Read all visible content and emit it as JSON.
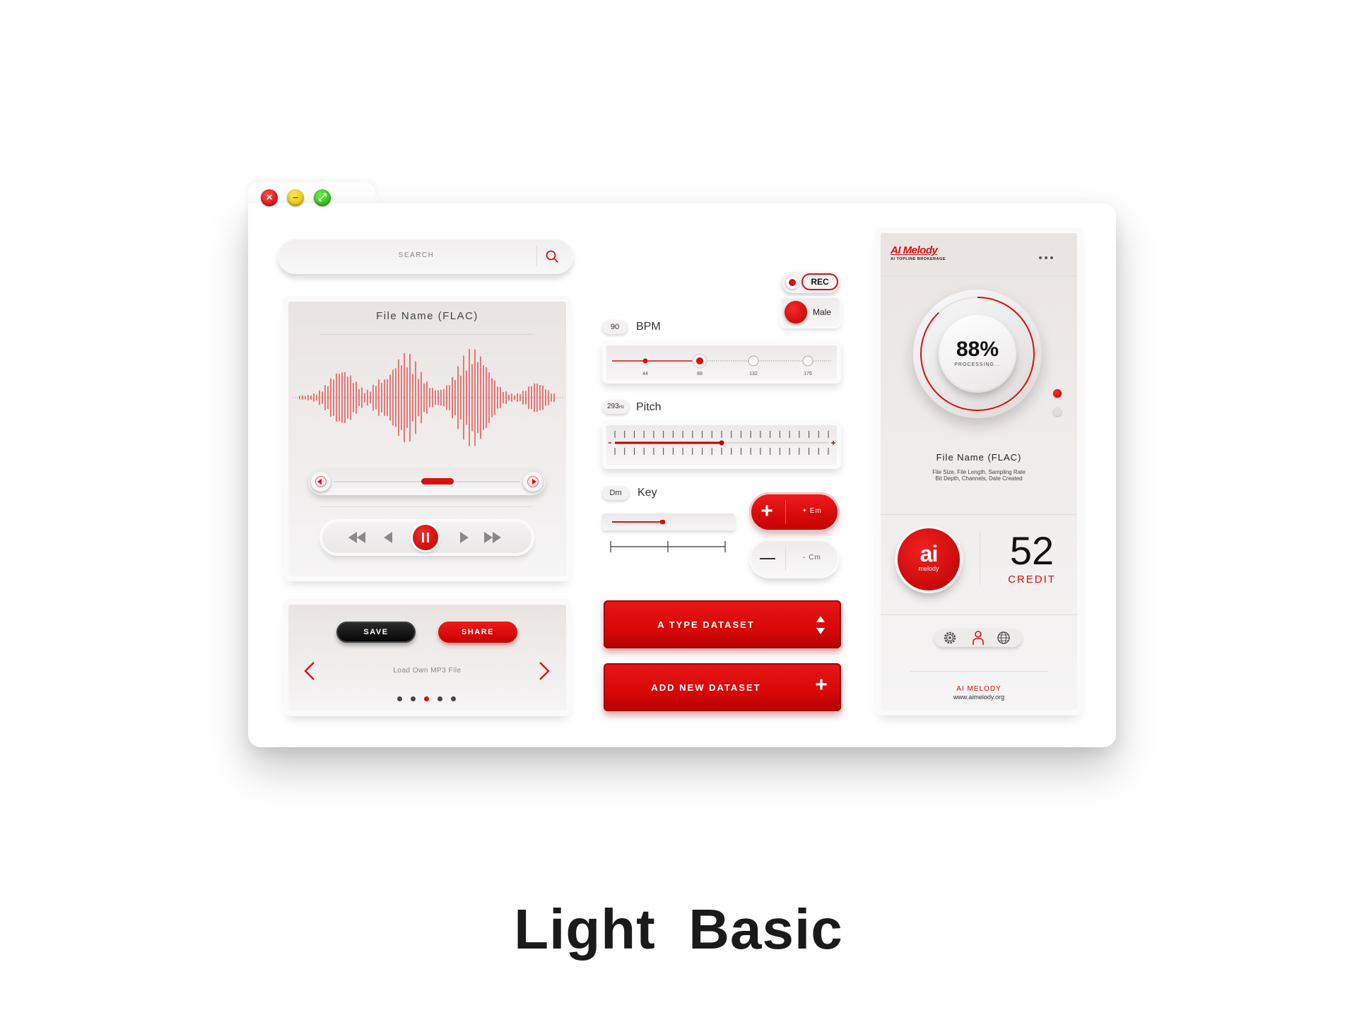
{
  "colors": {
    "accent": "#e01010",
    "dark": "#111111",
    "panel": "#ece8e7"
  },
  "search": {
    "placeholder": "SEARCH"
  },
  "player": {
    "file_name": "File Name (FLAC)",
    "controls": [
      "rewind-icon",
      "prev-icon",
      "pause-icon",
      "play-icon",
      "fast-forward-icon"
    ]
  },
  "file_panel": {
    "save_label": "SAVE",
    "share_label": "SHARE",
    "hint": "Load Own MP3 File",
    "page_count": 5,
    "active_page": 3
  },
  "rec": {
    "label": "REC",
    "voice_label": "Male"
  },
  "bpm": {
    "value": "90",
    "label": "BPM",
    "ticks": [
      "44",
      "88",
      "132",
      "176"
    ],
    "level": 0.38
  },
  "pitch": {
    "value": "293",
    "unit": "Hz",
    "label": "Pitch",
    "level": 0.5
  },
  "key": {
    "value": "Dm",
    "label": "Key",
    "level": 0.45
  },
  "key_buttons": {
    "plus_label": "+ Em",
    "minus_label": "- Cm"
  },
  "dataset": {
    "type_label": "A TYPE DATASET",
    "add_label": "ADD NEW DATASET"
  },
  "side": {
    "brand": "AI Melody",
    "brand_tagline": "AI TOPLINE BROKERAGE",
    "progress_value": "88%",
    "progress_level": 0.88,
    "progress_label": "PROCESSING...",
    "file_name": "File Name (FLAC)",
    "file_meta_1": "File Size, File Length, Sampling Rate",
    "file_meta_2": "Bit Depth, Channels, Date Created",
    "logo_main": "ai",
    "logo_sub": "melody",
    "credit_value": "52",
    "credit_label": "CREDIT",
    "footer_title": "AI MELODY",
    "footer_url": "www.aimelody.org"
  },
  "caption": "Light  Basic"
}
